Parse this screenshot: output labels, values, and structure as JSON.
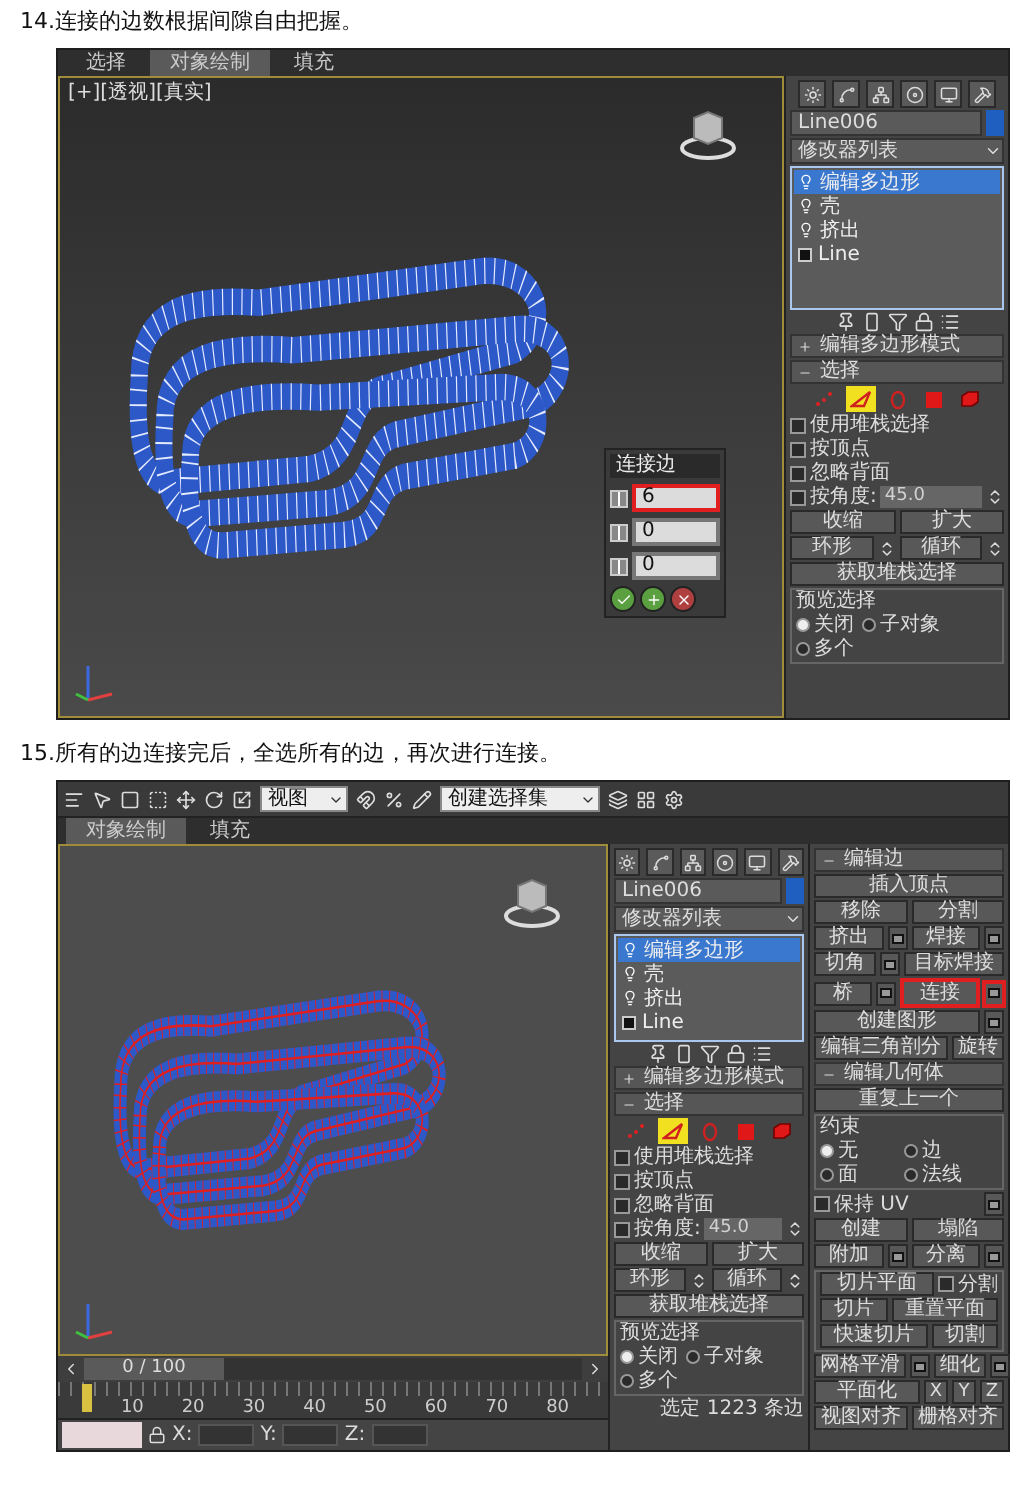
{
  "steps": [
    {
      "caption": "14.连接的边数根据间隙自由把握。",
      "screenshot": {
        "tabs": [
          {
            "label": "选择",
            "selected": false
          },
          {
            "label": "对象绘制",
            "selected": true
          },
          {
            "label": "填充",
            "selected": false
          }
        ],
        "viewport": {
          "label": "[+][透视][真实]",
          "edges_selected": false,
          "caddy": {
            "title": "连接边",
            "fields": [
              {
                "value": "6",
                "highlighted": true
              },
              {
                "value": "0",
                "highlighted": false
              },
              {
                "value": "0",
                "highlighted": false
              }
            ]
          }
        },
        "panels": [
          {
            "kind": "modify",
            "object_name": "Line006",
            "modifier_list": "修改器列表",
            "stack": [
              {
                "label": "编辑多边形",
                "kind": "modifier",
                "selected": true
              },
              {
                "label": "壳",
                "kind": "modifier",
                "selected": false
              },
              {
                "label": "挤出",
                "kind": "modifier",
                "selected": false
              },
              {
                "label": "Line",
                "kind": "base",
                "selected": false
              }
            ],
            "mode_rollout": {
              "title": "编辑多边形模式",
              "expanded": false
            },
            "selection": {
              "title": "选择",
              "expanded": true,
              "levels": [
                {
                  "kind": "vertex",
                  "selected": false
                },
                {
                  "kind": "edge",
                  "selected": true
                },
                {
                  "kind": "border",
                  "selected": false
                },
                {
                  "kind": "polygon",
                  "selected": false
                },
                {
                  "kind": "element",
                  "selected": false
                }
              ],
              "checkboxes": [
                {
                  "label": "使用堆栈选择",
                  "checked": false
                },
                {
                  "label": "按顶点",
                  "checked": false
                },
                {
                  "label": "忽略背面",
                  "checked": false
                }
              ],
              "angle": {
                "label": "按角度:",
                "checked": false,
                "value": "45.0"
              },
              "buttons": [
                "收缩",
                "扩大"
              ],
              "loop_buttons": [
                "环形",
                "循环"
              ],
              "get_button": "获取堆栈选择",
              "preview": {
                "title": "预览选择",
                "options": [
                  {
                    "label": "关闭",
                    "selected": true
                  },
                  {
                    "label": "子对象",
                    "selected": false
                  },
                  {
                    "label": "多个",
                    "selected": false
                  }
                ]
              }
            }
          }
        ]
      }
    },
    {
      "caption": "15.所有的边连接完后，全选所有的边，再次进行连接。",
      "screenshot": {
        "toolbar": {
          "view_dropdown": "视图",
          "selection_set": "创建选择集"
        },
        "tabs": [
          {
            "label": "对象绘制",
            "selected": true
          },
          {
            "label": "填充",
            "selected": false
          }
        ],
        "viewport": {
          "edges_selected": true
        },
        "timeline": {
          "frame": "0 / 100",
          "level": 0,
          "ticks": [
            "10",
            "20",
            "30",
            "40",
            "50",
            "60",
            "70",
            "80"
          ]
        },
        "status_bar": {
          "coords": [
            "X:",
            "Y:",
            "Z:"
          ]
        },
        "panels": [
          {
            "kind": "modify",
            "object_name": "Line006",
            "modifier_list": "修改器列表",
            "stack": [
              {
                "label": "编辑多边形",
                "kind": "modifier",
                "selected": true
              },
              {
                "label": "壳",
                "kind": "modifier",
                "selected": false
              },
              {
                "label": "挤出",
                "kind": "modifier",
                "selected": false
              },
              {
                "label": "Line",
                "kind": "base",
                "selected": false
              }
            ],
            "mode_rollout": {
              "title": "编辑多边形模式",
              "expanded": false
            },
            "selection": {
              "title": "选择",
              "expanded": true,
              "levels": [
                {
                  "kind": "vertex",
                  "selected": false
                },
                {
                  "kind": "edge",
                  "selected": true
                },
                {
                  "kind": "border",
                  "selected": false
                },
                {
                  "kind": "polygon",
                  "selected": false
                },
                {
                  "kind": "element",
                  "selected": false
                }
              ],
              "checkboxes": [
                {
                  "label": "使用堆栈选择",
                  "checked": false
                },
                {
                  "label": "按顶点",
                  "checked": false
                },
                {
                  "label": "忽略背面",
                  "checked": false
                }
              ],
              "angle": {
                "label": "按角度:",
                "checked": false,
                "value": "45.0"
              },
              "buttons": [
                "收缩",
                "扩大"
              ],
              "loop_buttons": [
                "环形",
                "循环"
              ],
              "get_button": "获取堆栈选择",
              "preview": {
                "title": "预览选择",
                "options": [
                  {
                    "label": "关闭",
                    "selected": true
                  },
                  {
                    "label": "子对象",
                    "selected": false
                  },
                  {
                    "label": "多个",
                    "selected": false
                  }
                ]
              },
              "info": "选定 1223 条边"
            }
          },
          {
            "kind": "edit_edges",
            "title": "编辑边",
            "expanded": true,
            "rows": [
              [
                {
                  "kind": "button",
                  "label": "插入顶点",
                  "settings": false,
                  "highlighted": false
                }
              ],
              [
                {
                  "kind": "button",
                  "label": "移除",
                  "settings": false,
                  "highlighted": false
                },
                {
                  "kind": "button",
                  "label": "分割",
                  "settings": false,
                  "highlighted": false
                }
              ],
              [
                {
                  "kind": "button",
                  "label": "挤出",
                  "settings": true,
                  "highlighted": false
                },
                {
                  "kind": "button",
                  "label": "焊接",
                  "settings": true,
                  "highlighted": false
                }
              ],
              [
                {
                  "kind": "button",
                  "label": "切角",
                  "settings": true,
                  "highlighted": false
                },
                {
                  "kind": "button",
                  "label": "目标焊接",
                  "settings": false,
                  "highlighted": false
                }
              ],
              [
                {
                  "kind": "button",
                  "label": "桥",
                  "settings": true,
                  "highlighted": false
                },
                {
                  "kind": "button",
                  "label": "连接",
                  "settings": true,
                  "highlighted": true
                }
              ],
              [
                {
                  "kind": "button",
                  "label": "创建图形",
                  "settings": true,
                  "highlighted": false
                }
              ],
              [
                {
                  "kind": "button",
                  "label": "编辑三角剖分",
                  "settings": false,
                  "highlighted": false
                },
                {
                  "kind": "button",
                  "label": "旋转",
                  "settings": false,
                  "highlighted": false
                }
              ]
            ],
            "geometry": {
              "title": "编辑几何体",
              "expanded": true,
              "repeat": "重复上一个",
              "constraint": {
                "title": "约束",
                "options": [
                  {
                    "label": "无",
                    "selected": true
                  },
                  {
                    "label": "边",
                    "selected": false
                  },
                  {
                    "label": "面",
                    "selected": false
                  },
                  {
                    "label": "法线",
                    "selected": false
                  }
                ]
              },
              "preserve_uv": {
                "label": "保持 UV",
                "checked": false
              },
              "rows": [
                [
                  {
                    "kind": "button",
                    "label": "创建",
                    "settings": false,
                    "highlighted": false
                  },
                  {
                    "kind": "button",
                    "label": "塌陷",
                    "settings": false,
                    "highlighted": false
                  }
                ],
                [
                  {
                    "kind": "button",
                    "label": "附加",
                    "settings": true,
                    "highlighted": false
                  },
                  {
                    "kind": "button",
                    "label": "分离",
                    "settings": true,
                    "highlighted": false
                  }
                ]
              ],
              "slice_rows": [
                [
                  {
                    "kind": "button",
                    "label": "切片平面",
                    "settings": false,
                    "highlighted": false
                  },
                  {
                    "kind": "checkbox",
                    "label": "分割",
                    "checked": false
                  }
                ],
                [
                  {
                    "kind": "button",
                    "label": "切片",
                    "settings": false,
                    "highlighted": false
                  },
                  {
                    "kind": "button",
                    "label": "重置平面",
                    "settings": false,
                    "highlighted": false
                  }
                ],
                [
                  {
                    "kind": "button",
                    "label": "快速切片",
                    "settings": false,
                    "highlighted": false
                  },
                  {
                    "kind": "button",
                    "label": "切割",
                    "settings": false,
                    "highlighted": false
                  }
                ]
              ],
              "bottom_rows": [
                [
                  {
                    "kind": "button",
                    "label": "网格平滑",
                    "settings": true,
                    "highlighted": false
                  },
                  {
                    "kind": "button",
                    "label": "细化",
                    "settings": true,
                    "highlighted": false
                  }
                ],
                [
                  {
                    "kind": "button",
                    "label": "平面化",
                    "settings": false,
                    "highlighted": false
                  },
                  {
                    "kind": "axis",
                    "label": "X"
                  },
                  {
                    "kind": "axis",
                    "label": "Y"
                  },
                  {
                    "kind": "axis",
                    "label": "Z"
                  }
                ],
                [
                  {
                    "kind": "button",
                    "label": "视图对齐",
                    "settings": false,
                    "highlighted": false
                  },
                  {
                    "kind": "button",
                    "label": "栅格对齐",
                    "settings": false,
                    "highlighted": false
                  }
                ]
              ]
            }
          }
        ]
      }
    }
  ]
}
